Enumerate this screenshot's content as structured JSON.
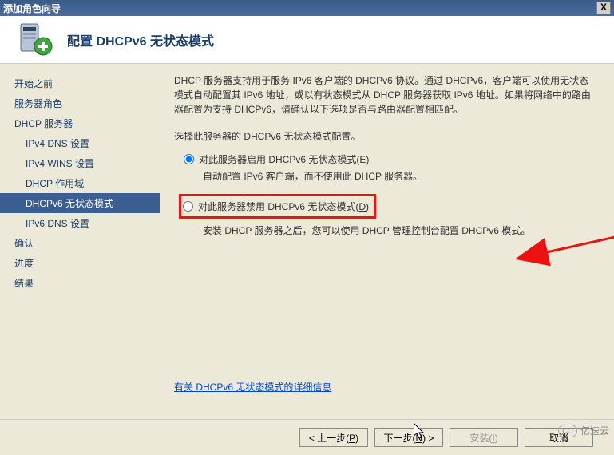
{
  "window": {
    "title": "添加角色向导",
    "close_alt": "关闭"
  },
  "header": {
    "title": "配置 DHCPv6 无状态模式"
  },
  "nav": {
    "items": [
      "开始之前",
      "服务器角色",
      "DHCP 服务器",
      "IPv4 DNS 设置",
      "IPv4 WINS 设置",
      "DHCP 作用域",
      "DHCPv6 无状态模式",
      "IPv6 DNS 设置",
      "确认",
      "进度",
      "结果"
    ],
    "active_index": 6
  },
  "content": {
    "intro": "DHCP 服务器支持用于服务 IPv6 客户端的 DHCPv6 协议。通过 DHCPv6，客户端可以使用无状态模式自动配置其 IPv6 地址，或以有状态模式从 DHCP 服务器获取 IPv6 地址。如果将网络中的路由器配置为支持 DHCPv6，请确认以下选项是否与路由器配置相匹配。",
    "choose": "选择此服务器的 DHCPv6 无状态模式配置。",
    "option1": {
      "label_pre": "对此服务器启用 DHCPv6 无状态模式(",
      "hotkey": "E",
      "label_post": ")",
      "desc": "自动配置 IPv6 客户端，而不使用此 DHCP 服务器。"
    },
    "option2": {
      "label_pre": "对此服务器禁用 DHCPv6 无状态模式(",
      "hotkey": "D",
      "label_post": ")",
      "desc": "安装 DHCP 服务器之后，您可以使用 DHCP 管理控制台配置 DHCPv6 模式。"
    },
    "selected": "option1",
    "help_link": "有关 DHCPv6 无状态模式的详细信息"
  },
  "footer": {
    "prev_pre": "< 上一步(",
    "prev_hk": "P",
    "prev_post": ")",
    "next_pre": "下一步(",
    "next_hk": "N",
    "next_post": ") >",
    "install_pre": "安装(",
    "install_hk": "I",
    "install_post": ")",
    "cancel": "取消"
  },
  "watermark": {
    "cloud": "CO",
    "text": "亿速云"
  }
}
